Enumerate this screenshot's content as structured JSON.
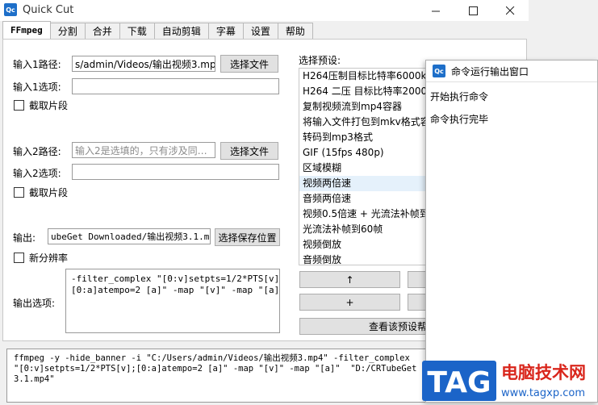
{
  "window": {
    "icon_text": "Qc",
    "title": "Quick Cut"
  },
  "tabs": [
    "FFmpeg",
    "分割",
    "合并",
    "下载",
    "自动剪辑",
    "字幕",
    "设置",
    "帮助"
  ],
  "input1": {
    "path_label": "输入1路径:",
    "path_value": "s/admin/Videos/输出视频3.mp4",
    "browse_button": "选择文件",
    "options_label": "输入1选项:",
    "options_value": "",
    "clip_label": "截取片段"
  },
  "input2": {
    "path_label": "输入2路径:",
    "path_placeholder": "输入2是选填的，只有涉及同…",
    "browse_button": "选择文件",
    "options_label": "输入2选项:",
    "options_value": "",
    "clip_label": "截取片段"
  },
  "output": {
    "label": "输出:",
    "value": "ubeGet Downloaded/输出视频3.1.mp4",
    "save_button": "选择保存位置",
    "resolution_label": "新分辨率",
    "options_label": "输出选项:",
    "options_value": "-filter_complex \"[0:v]setpts=1/2*PTS[v];\n[0:a]atempo=2 [a]\" -map \"[v]\" -map \"[a]\""
  },
  "presets": {
    "label": "选择预设:",
    "items": [
      "H264压制目标比特率6000k",
      "H264 二压 目标比特率2000",
      "复制视频流到mp4容器",
      "将输入文件打包到mkv格式容",
      "转码到mp3格式",
      "GIF (15fps 480p)",
      "区域模糊",
      "视频两倍速",
      "音频两倍速",
      "视频0.5倍速 + 光流法补帧到",
      "光流法补帧到60帧",
      "视频倒放",
      "音频倒放"
    ],
    "selected_index": 7,
    "up_button": "↑",
    "add_button": "+",
    "view_button": "查看该预设帮"
  },
  "command": "ffmpeg -y -hide_banner -i \"C:/Users/admin/Videos/输出视频3.mp4\" -filter_complex\n\"[0:v]setpts=1/2*PTS[v];[0:a]atempo=2 [a]\" -map \"[v]\" -map \"[a]\"  \"D:/CRTubeGet Down\n3.1.mp4\"",
  "output_window": {
    "icon_text": "Qc",
    "title": "命令运行输出窗口",
    "lines": [
      "开始执行命令",
      "命令执行完毕"
    ]
  },
  "watermark": {
    "logo": "TAG",
    "site_name": "电脑技术网",
    "url": "www.tagxp.com"
  },
  "icons": {
    "minimize": "minimize-icon",
    "maximize": "maximize-icon",
    "close": "close-icon"
  },
  "colors": {
    "accent": "#1e6fc9",
    "selected_row": "#e5f1fb",
    "watermark_red": "#d9261c",
    "watermark_blue": "#1b64c8"
  }
}
